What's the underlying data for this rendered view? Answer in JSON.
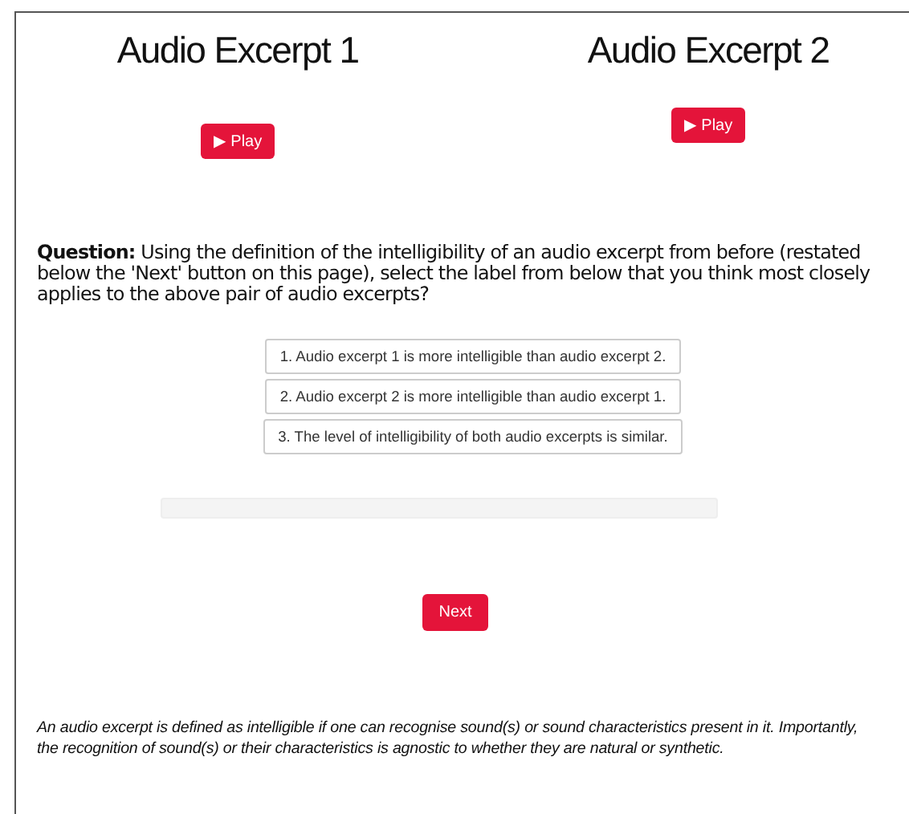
{
  "excerpts": [
    {
      "title": "Audio Excerpt 1",
      "play_button": "▶ Play"
    },
    {
      "title": "Audio Excerpt 2",
      "play_button": "▶ Play"
    }
  ],
  "question": {
    "text": "**Question:** Using the definition of the intelligibility of an audio excerpt from before (restated below the 'Next' button on this page), select the label from below that you think most closely applies to the above pair of audio excerpts?"
  },
  "options": [
    {
      "label": "1. Audio excerpt 1 is more intelligible than audio excerpt 2.",
      "selected": false
    },
    {
      "label": "2. Audio excerpt 2 is more intelligible than audio excerpt 1.",
      "selected": false
    },
    {
      "label": "3. The level of intelligibility of both audio excerpts is similar.",
      "selected": false
    }
  ],
  "progress": {
    "level": 0
  },
  "next_button": "Next",
  "definition": [
    "An audio excerpt is defined as intelligible if one can recognise sound(s) or sound characteristics present in it. Importantly,",
    "the recognition of sound(s) or their characteristics is agnostic to whether they are natural or synthetic."
  ]
}
